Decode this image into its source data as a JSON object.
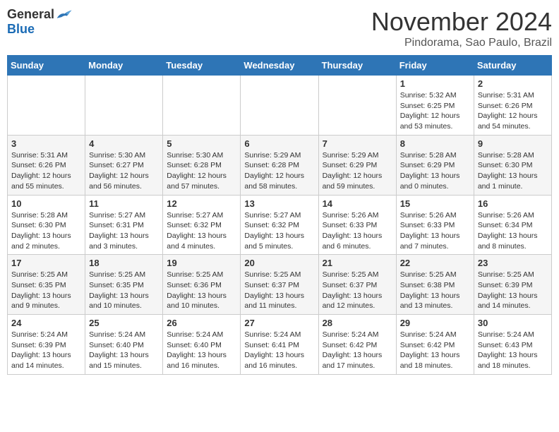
{
  "logo": {
    "general": "General",
    "blue": "Blue"
  },
  "title": "November 2024",
  "location": "Pindorama, Sao Paulo, Brazil",
  "days_header": [
    "Sunday",
    "Monday",
    "Tuesday",
    "Wednesday",
    "Thursday",
    "Friday",
    "Saturday"
  ],
  "weeks": [
    [
      {
        "day": "",
        "info": ""
      },
      {
        "day": "",
        "info": ""
      },
      {
        "day": "",
        "info": ""
      },
      {
        "day": "",
        "info": ""
      },
      {
        "day": "",
        "info": ""
      },
      {
        "day": "1",
        "info": "Sunrise: 5:32 AM\nSunset: 6:25 PM\nDaylight: 12 hours and 53 minutes."
      },
      {
        "day": "2",
        "info": "Sunrise: 5:31 AM\nSunset: 6:26 PM\nDaylight: 12 hours and 54 minutes."
      }
    ],
    [
      {
        "day": "3",
        "info": "Sunrise: 5:31 AM\nSunset: 6:26 PM\nDaylight: 12 hours and 55 minutes."
      },
      {
        "day": "4",
        "info": "Sunrise: 5:30 AM\nSunset: 6:27 PM\nDaylight: 12 hours and 56 minutes."
      },
      {
        "day": "5",
        "info": "Sunrise: 5:30 AM\nSunset: 6:28 PM\nDaylight: 12 hours and 57 minutes."
      },
      {
        "day": "6",
        "info": "Sunrise: 5:29 AM\nSunset: 6:28 PM\nDaylight: 12 hours and 58 minutes."
      },
      {
        "day": "7",
        "info": "Sunrise: 5:29 AM\nSunset: 6:29 PM\nDaylight: 12 hours and 59 minutes."
      },
      {
        "day": "8",
        "info": "Sunrise: 5:28 AM\nSunset: 6:29 PM\nDaylight: 13 hours and 0 minutes."
      },
      {
        "day": "9",
        "info": "Sunrise: 5:28 AM\nSunset: 6:30 PM\nDaylight: 13 hours and 1 minute."
      }
    ],
    [
      {
        "day": "10",
        "info": "Sunrise: 5:28 AM\nSunset: 6:30 PM\nDaylight: 13 hours and 2 minutes."
      },
      {
        "day": "11",
        "info": "Sunrise: 5:27 AM\nSunset: 6:31 PM\nDaylight: 13 hours and 3 minutes."
      },
      {
        "day": "12",
        "info": "Sunrise: 5:27 AM\nSunset: 6:32 PM\nDaylight: 13 hours and 4 minutes."
      },
      {
        "day": "13",
        "info": "Sunrise: 5:27 AM\nSunset: 6:32 PM\nDaylight: 13 hours and 5 minutes."
      },
      {
        "day": "14",
        "info": "Sunrise: 5:26 AM\nSunset: 6:33 PM\nDaylight: 13 hours and 6 minutes."
      },
      {
        "day": "15",
        "info": "Sunrise: 5:26 AM\nSunset: 6:33 PM\nDaylight: 13 hours and 7 minutes."
      },
      {
        "day": "16",
        "info": "Sunrise: 5:26 AM\nSunset: 6:34 PM\nDaylight: 13 hours and 8 minutes."
      }
    ],
    [
      {
        "day": "17",
        "info": "Sunrise: 5:25 AM\nSunset: 6:35 PM\nDaylight: 13 hours and 9 minutes."
      },
      {
        "day": "18",
        "info": "Sunrise: 5:25 AM\nSunset: 6:35 PM\nDaylight: 13 hours and 10 minutes."
      },
      {
        "day": "19",
        "info": "Sunrise: 5:25 AM\nSunset: 6:36 PM\nDaylight: 13 hours and 10 minutes."
      },
      {
        "day": "20",
        "info": "Sunrise: 5:25 AM\nSunset: 6:37 PM\nDaylight: 13 hours and 11 minutes."
      },
      {
        "day": "21",
        "info": "Sunrise: 5:25 AM\nSunset: 6:37 PM\nDaylight: 13 hours and 12 minutes."
      },
      {
        "day": "22",
        "info": "Sunrise: 5:25 AM\nSunset: 6:38 PM\nDaylight: 13 hours and 13 minutes."
      },
      {
        "day": "23",
        "info": "Sunrise: 5:25 AM\nSunset: 6:39 PM\nDaylight: 13 hours and 14 minutes."
      }
    ],
    [
      {
        "day": "24",
        "info": "Sunrise: 5:24 AM\nSunset: 6:39 PM\nDaylight: 13 hours and 14 minutes."
      },
      {
        "day": "25",
        "info": "Sunrise: 5:24 AM\nSunset: 6:40 PM\nDaylight: 13 hours and 15 minutes."
      },
      {
        "day": "26",
        "info": "Sunrise: 5:24 AM\nSunset: 6:40 PM\nDaylight: 13 hours and 16 minutes."
      },
      {
        "day": "27",
        "info": "Sunrise: 5:24 AM\nSunset: 6:41 PM\nDaylight: 13 hours and 16 minutes."
      },
      {
        "day": "28",
        "info": "Sunrise: 5:24 AM\nSunset: 6:42 PM\nDaylight: 13 hours and 17 minutes."
      },
      {
        "day": "29",
        "info": "Sunrise: 5:24 AM\nSunset: 6:42 PM\nDaylight: 13 hours and 18 minutes."
      },
      {
        "day": "30",
        "info": "Sunrise: 5:24 AM\nSunset: 6:43 PM\nDaylight: 13 hours and 18 minutes."
      }
    ]
  ]
}
